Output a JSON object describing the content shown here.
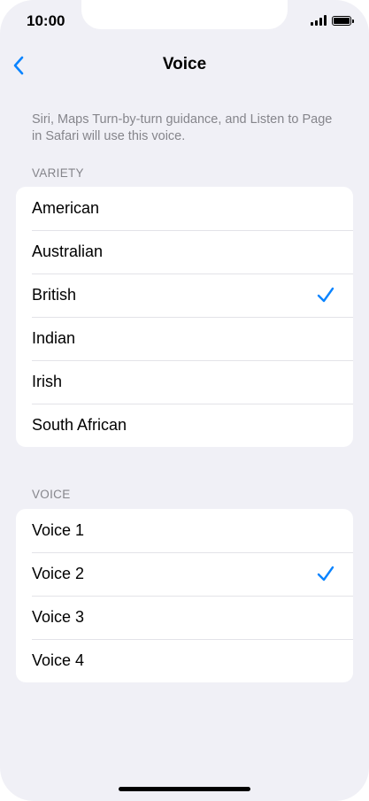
{
  "status_bar": {
    "time": "10:00",
    "signal_icon": "cellular-signal-icon",
    "battery_icon": "battery-icon",
    "battery_level": 1.0
  },
  "nav": {
    "title": "Voice",
    "back_icon": "chevron-left-icon",
    "accent_color": "#0a84ff"
  },
  "description": "Siri, Maps Turn-by-turn guidance, and Listen to Page in Safari will use this voice.",
  "variety": {
    "header": "VARIETY",
    "items": [
      {
        "label": "American",
        "selected": false
      },
      {
        "label": "Australian",
        "selected": false
      },
      {
        "label": "British",
        "selected": true
      },
      {
        "label": "Indian",
        "selected": false
      },
      {
        "label": "Irish",
        "selected": false
      },
      {
        "label": "South African",
        "selected": false
      }
    ]
  },
  "voice": {
    "header": "VOICE",
    "items": [
      {
        "label": "Voice 1",
        "selected": false
      },
      {
        "label": "Voice 2",
        "selected": true
      },
      {
        "label": "Voice 3",
        "selected": false
      },
      {
        "label": "Voice 4",
        "selected": false
      }
    ]
  },
  "checkmark_icon": "checkmark-icon"
}
